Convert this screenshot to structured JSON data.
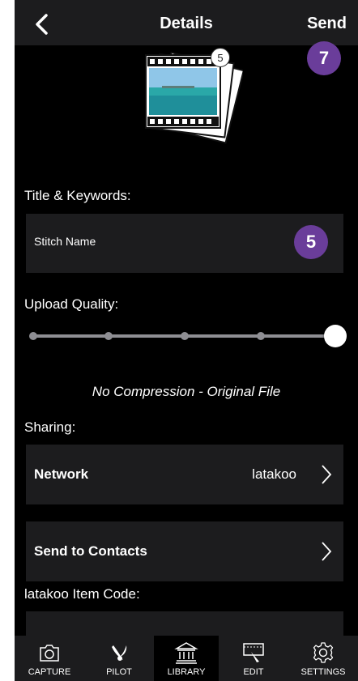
{
  "navbar": {
    "title": "Details",
    "send_label": "Send",
    "send_badge": "7"
  },
  "film_stack": {
    "count": "5"
  },
  "title_section": {
    "label": "Title & Keywords:",
    "field_value": "Stitch Name",
    "badge": "5"
  },
  "upload_quality": {
    "label": "Upload Quality:",
    "selected_step": 5,
    "total_steps": 5,
    "description": "No Compression - Original File"
  },
  "sharing": {
    "label": "Sharing:",
    "network_label": "Network",
    "network_value": "latakoo",
    "contacts_label": "Send to Contacts"
  },
  "item_code": {
    "label": "latakoo Item Code:"
  },
  "tabbar": {
    "active": "LIBRARY",
    "tabs": [
      {
        "label": "CAPTURE",
        "icon": "camera-icon"
      },
      {
        "label": "PILOT",
        "icon": "pilot-bird-icon"
      },
      {
        "label": "LIBRARY",
        "icon": "library-building-icon"
      },
      {
        "label": "EDIT",
        "icon": "edit-filmstrip-icon"
      },
      {
        "label": "SETTINGS",
        "icon": "gear-icon"
      }
    ]
  },
  "colors": {
    "badge": "#6a3d9a",
    "panel": "#1c1c1e",
    "background": "#000000"
  }
}
